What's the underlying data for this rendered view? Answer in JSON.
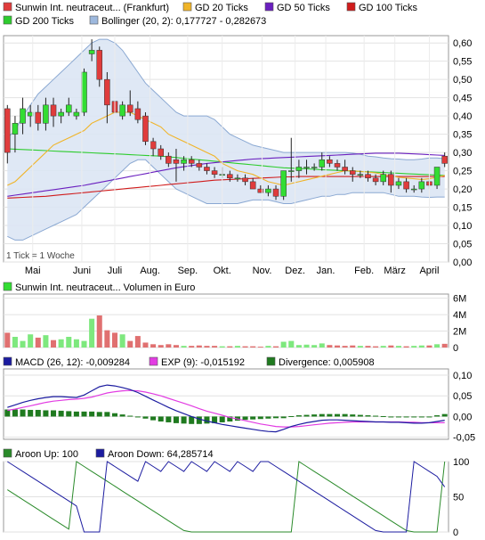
{
  "chart_data": [
    {
      "type": "candlestick",
      "legend": [
        {
          "label": "Sunwin Int. neutraceut... (Frankfurt)",
          "color": "#e03c3c"
        },
        {
          "label": "GD 20 Ticks",
          "color": "#f0b428"
        },
        {
          "label": "GD 50 Ticks",
          "color": "#6a1fbf"
        },
        {
          "label": "GD 100 Ticks",
          "color": "#d01c1c"
        },
        {
          "label": "GD 200 Ticks",
          "color": "#2ecc2e"
        },
        {
          "label": "Bollinger (20, 2): 0,177727 - 0,282673",
          "color": "#9db8dd"
        }
      ],
      "x_labels": [
        "Mai",
        "Juni",
        "Juli",
        "Aug.",
        "Sep.",
        "Okt.",
        "Nov.",
        "Dez.",
        "Jan.",
        "Feb.",
        "März",
        "April"
      ],
      "y_ticks": [
        "0,00",
        "0,05",
        "0,10",
        "0,15",
        "0,20",
        "0,25",
        "0,30",
        "0,35",
        "0,40",
        "0,45",
        "0,50",
        "0,55",
        "0,60"
      ],
      "ylim": [
        0,
        0.62
      ],
      "note": "1 Tick = 1 Woche",
      "colors": {
        "up": "#33dd33",
        "down": "#e03c3c",
        "band_fill": "#dbe6f4",
        "band_line": "#8aa8d2"
      },
      "candles": [
        [
          0.42,
          0.43,
          0.27,
          0.3
        ],
        [
          0.35,
          0.4,
          0.3,
          0.38
        ],
        [
          0.38,
          0.45,
          0.35,
          0.42
        ],
        [
          0.4,
          0.43,
          0.37,
          0.41
        ],
        [
          0.41,
          0.43,
          0.36,
          0.38
        ],
        [
          0.38,
          0.45,
          0.36,
          0.43
        ],
        [
          0.43,
          0.45,
          0.37,
          0.4
        ],
        [
          0.4,
          0.42,
          0.38,
          0.41
        ],
        [
          0.41,
          0.45,
          0.4,
          0.43
        ],
        [
          0.4,
          0.42,
          0.39,
          0.41
        ],
        [
          0.41,
          0.53,
          0.4,
          0.52
        ],
        [
          0.57,
          0.61,
          0.55,
          0.58
        ],
        [
          0.58,
          0.59,
          0.48,
          0.5
        ],
        [
          0.5,
          0.52,
          0.38,
          0.43
        ],
        [
          0.44,
          0.46,
          0.39,
          0.41
        ],
        [
          0.4,
          0.44,
          0.39,
          0.43
        ],
        [
          0.43,
          0.47,
          0.4,
          0.41
        ],
        [
          0.42,
          0.44,
          0.38,
          0.39
        ],
        [
          0.4,
          0.41,
          0.32,
          0.33
        ],
        [
          0.33,
          0.34,
          0.29,
          0.31
        ],
        [
          0.31,
          0.32,
          0.28,
          0.29
        ],
        [
          0.29,
          0.3,
          0.26,
          0.27
        ],
        [
          0.28,
          0.31,
          0.22,
          0.27
        ],
        [
          0.27,
          0.29,
          0.25,
          0.28
        ],
        [
          0.28,
          0.29,
          0.26,
          0.27
        ],
        [
          0.27,
          0.28,
          0.25,
          0.26
        ],
        [
          0.26,
          0.27,
          0.24,
          0.25
        ],
        [
          0.25,
          0.26,
          0.23,
          0.24
        ],
        [
          0.24,
          0.26,
          0.23,
          0.24
        ],
        [
          0.24,
          0.25,
          0.22,
          0.23
        ],
        [
          0.23,
          0.24,
          0.22,
          0.23
        ],
        [
          0.23,
          0.24,
          0.21,
          0.22
        ],
        [
          0.22,
          0.23,
          0.2,
          0.2
        ],
        [
          0.2,
          0.21,
          0.19,
          0.19
        ],
        [
          0.19,
          0.21,
          0.18,
          0.2
        ],
        [
          0.2,
          0.21,
          0.17,
          0.18
        ],
        [
          0.18,
          0.25,
          0.17,
          0.25
        ],
        [
          0.25,
          0.34,
          0.22,
          0.25
        ],
        [
          0.25,
          0.28,
          0.23,
          0.26
        ],
        [
          0.26,
          0.28,
          0.24,
          0.26
        ],
        [
          0.26,
          0.27,
          0.25,
          0.26
        ],
        [
          0.26,
          0.3,
          0.25,
          0.28
        ],
        [
          0.28,
          0.29,
          0.26,
          0.27
        ],
        [
          0.27,
          0.28,
          0.25,
          0.26
        ],
        [
          0.26,
          0.28,
          0.24,
          0.25
        ],
        [
          0.25,
          0.26,
          0.22,
          0.24
        ],
        [
          0.24,
          0.25,
          0.23,
          0.24
        ],
        [
          0.24,
          0.25,
          0.22,
          0.23
        ],
        [
          0.23,
          0.24,
          0.21,
          0.22
        ],
        [
          0.22,
          0.25,
          0.21,
          0.24
        ],
        [
          0.24,
          0.25,
          0.19,
          0.21
        ],
        [
          0.21,
          0.23,
          0.2,
          0.22
        ],
        [
          0.22,
          0.23,
          0.19,
          0.2
        ],
        [
          0.2,
          0.21,
          0.19,
          0.2
        ],
        [
          0.2,
          0.23,
          0.19,
          0.22
        ],
        [
          0.22,
          0.23,
          0.2,
          0.21
        ],
        [
          0.21,
          0.26,
          0.2,
          0.26
        ],
        [
          0.29,
          0.3,
          0.26,
          0.27
        ]
      ],
      "ma20": [
        0.21,
        0.22,
        0.24,
        0.26,
        0.28,
        0.3,
        0.32,
        0.33,
        0.34,
        0.35,
        0.36,
        0.38,
        0.39,
        0.4,
        0.41,
        0.41,
        0.41,
        0.4,
        0.39,
        0.38,
        0.37,
        0.35,
        0.34,
        0.33,
        0.32,
        0.31,
        0.3,
        0.29,
        0.27,
        0.26,
        0.25,
        0.245,
        0.24,
        0.23,
        0.22,
        0.215,
        0.21,
        0.215,
        0.22,
        0.225,
        0.23,
        0.235,
        0.24,
        0.245,
        0.25,
        0.25,
        0.248,
        0.246,
        0.244,
        0.24,
        0.236,
        0.232,
        0.23,
        0.228,
        0.226,
        0.228,
        0.232,
        0.237
      ],
      "ma50": [
        0.18,
        0.183,
        0.186,
        0.189,
        0.192,
        0.195,
        0.198,
        0.201,
        0.204,
        0.207,
        0.21,
        0.214,
        0.218,
        0.222,
        0.226,
        0.23,
        0.234,
        0.238,
        0.242,
        0.246,
        0.25,
        0.254,
        0.258,
        0.261,
        0.264,
        0.267,
        0.27,
        0.272,
        0.274,
        0.276,
        0.278,
        0.28,
        0.282,
        0.283,
        0.284,
        0.285,
        0.286,
        0.287,
        0.288,
        0.289,
        0.29,
        0.291,
        0.292,
        0.293,
        0.294,
        0.295,
        0.296,
        0.297,
        0.298,
        0.298,
        0.298,
        0.298,
        0.297,
        0.296,
        0.295,
        0.294,
        0.293,
        0.292
      ],
      "ma100": [
        0.175,
        0.176,
        0.177,
        0.178,
        0.179,
        0.18,
        0.182,
        0.184,
        0.186,
        0.188,
        0.19,
        0.192,
        0.194,
        0.196,
        0.198,
        0.2,
        0.202,
        0.204,
        0.206,
        0.208,
        0.21,
        0.212,
        0.214,
        0.216,
        0.218,
        0.22,
        0.222,
        0.224,
        0.225,
        0.226,
        0.227,
        0.228,
        0.229,
        0.23,
        0.231,
        0.232,
        0.233,
        0.233,
        0.234,
        0.234,
        0.234,
        0.234,
        0.234,
        0.234,
        0.234,
        0.234,
        0.234,
        0.234,
        0.234,
        0.234,
        0.234,
        0.234,
        0.234,
        0.234,
        0.234,
        0.234,
        0.234,
        0.234
      ],
      "ma200": [
        0.31,
        0.309,
        0.308,
        0.307,
        0.306,
        0.305,
        0.304,
        0.303,
        0.302,
        0.301,
        0.3,
        0.299,
        0.298,
        0.297,
        0.296,
        0.295,
        0.294,
        0.293,
        0.292,
        0.291,
        0.29,
        0.288,
        0.286,
        0.284,
        0.282,
        0.28,
        0.278,
        0.276,
        0.274,
        0.272,
        0.27,
        0.268,
        0.266,
        0.264,
        0.262,
        0.26,
        0.258,
        0.257,
        0.256,
        0.255,
        0.254,
        0.253,
        0.252,
        0.251,
        0.25,
        0.249,
        0.248,
        0.247,
        0.246,
        0.245,
        0.244,
        0.243,
        0.242,
        0.241,
        0.24,
        0.239,
        0.238,
        0.237
      ],
      "boll_upper": [
        0.34,
        0.36,
        0.4,
        0.43,
        0.46,
        0.48,
        0.5,
        0.52,
        0.54,
        0.56,
        0.58,
        0.6,
        0.61,
        0.61,
        0.6,
        0.58,
        0.55,
        0.52,
        0.49,
        0.47,
        0.45,
        0.43,
        0.41,
        0.4,
        0.4,
        0.4,
        0.4,
        0.39,
        0.37,
        0.35,
        0.34,
        0.33,
        0.32,
        0.315,
        0.31,
        0.305,
        0.3,
        0.3,
        0.3,
        0.3,
        0.3,
        0.3,
        0.3,
        0.3,
        0.3,
        0.298,
        0.295,
        0.29,
        0.288,
        0.285,
        0.283,
        0.282,
        0.28,
        0.28,
        0.282,
        0.285,
        0.285,
        0.283
      ],
      "boll_lower": [
        0.07,
        0.06,
        0.06,
        0.07,
        0.08,
        0.09,
        0.1,
        0.11,
        0.12,
        0.13,
        0.15,
        0.17,
        0.19,
        0.21,
        0.23,
        0.25,
        0.27,
        0.28,
        0.28,
        0.26,
        0.24,
        0.22,
        0.2,
        0.19,
        0.18,
        0.17,
        0.16,
        0.16,
        0.16,
        0.16,
        0.16,
        0.165,
        0.17,
        0.17,
        0.17,
        0.165,
        0.16,
        0.16,
        0.165,
        0.17,
        0.175,
        0.18,
        0.18,
        0.185,
        0.185,
        0.19,
        0.19,
        0.19,
        0.19,
        0.19,
        0.185,
        0.18,
        0.18,
        0.18,
        0.178,
        0.177,
        0.178,
        0.178
      ]
    },
    {
      "type": "bar",
      "legend": [
        {
          "label": "Sunwin Int. neutraceut... Volumen in Euro",
          "color": "#33dd33"
        }
      ],
      "y_ticks": [
        "0",
        "2M",
        "4M",
        "6M"
      ],
      "ylim": [
        0,
        6500000
      ],
      "values": [
        1800000,
        1300000,
        800000,
        1600000,
        1200000,
        1500000,
        900000,
        1000000,
        1300000,
        1000000,
        800000,
        3500000,
        3900000,
        2100000,
        1800000,
        1600000,
        800000,
        1400000,
        600000,
        400000,
        300000,
        400000,
        300000,
        200000,
        200000,
        250000,
        200000,
        200000,
        150000,
        150000,
        200000,
        150000,
        150000,
        100000,
        200000,
        150000,
        700000,
        800000,
        300000,
        350000,
        300000,
        500000,
        300000,
        250000,
        200000,
        250000,
        200000,
        200000,
        150000,
        200000,
        250000,
        200000,
        150000,
        200000,
        250000,
        250000,
        400000,
        450000
      ]
    },
    {
      "type": "line",
      "legend": [
        {
          "label": "MACD (26, 12): -0,009284",
          "color": "#1c1ca0"
        },
        {
          "label": "EXP (9): -0,015192",
          "color": "#e23ce2"
        },
        {
          "label": "Divergence: 0,005908",
          "color": "#1f7a1f"
        }
      ],
      "y_ticks": [
        "-0,05",
        "0,00",
        "0,05",
        "0,10"
      ],
      "ylim": [
        -0.055,
        0.115
      ],
      "macd": [
        0.022,
        0.028,
        0.034,
        0.039,
        0.043,
        0.046,
        0.048,
        0.048,
        0.047,
        0.046,
        0.052,
        0.062,
        0.072,
        0.076,
        0.074,
        0.07,
        0.065,
        0.058,
        0.049,
        0.04,
        0.031,
        0.022,
        0.014,
        0.007,
        0.0,
        -0.006,
        -0.011,
        -0.015,
        -0.019,
        -0.022,
        -0.025,
        -0.028,
        -0.031,
        -0.034,
        -0.036,
        -0.037,
        -0.031,
        -0.024,
        -0.019,
        -0.015,
        -0.012,
        -0.009,
        -0.008,
        -0.008,
        -0.009,
        -0.01,
        -0.011,
        -0.012,
        -0.013,
        -0.013,
        -0.014,
        -0.014,
        -0.015,
        -0.016,
        -0.016,
        -0.015,
        -0.012,
        -0.009
      ],
      "signal": [
        0.015,
        0.018,
        0.022,
        0.026,
        0.03,
        0.034,
        0.037,
        0.039,
        0.041,
        0.042,
        0.044,
        0.047,
        0.052,
        0.057,
        0.06,
        0.062,
        0.063,
        0.062,
        0.059,
        0.055,
        0.05,
        0.044,
        0.038,
        0.032,
        0.026,
        0.019,
        0.013,
        0.008,
        0.003,
        -0.002,
        -0.006,
        -0.01,
        -0.014,
        -0.018,
        -0.021,
        -0.024,
        -0.025,
        -0.025,
        -0.024,
        -0.022,
        -0.02,
        -0.018,
        -0.016,
        -0.015,
        -0.014,
        -0.013,
        -0.013,
        -0.013,
        -0.013,
        -0.013,
        -0.013,
        -0.013,
        -0.014,
        -0.014,
        -0.015,
        -0.015,
        -0.015,
        -0.015
      ],
      "divergence": [
        0.017,
        0.017,
        0.017,
        0.016,
        0.016,
        0.015,
        0.015,
        0.014,
        0.013,
        0.012,
        0.012,
        0.012,
        0.011,
        0.011,
        0.008,
        0.005,
        0.002,
        -0.001,
        -0.005,
        -0.009,
        -0.012,
        -0.014,
        -0.016,
        -0.017,
        -0.018,
        -0.018,
        -0.017,
        -0.016,
        -0.014,
        -0.012,
        -0.01,
        -0.008,
        -0.007,
        -0.006,
        -0.005,
        -0.004,
        -0.004,
        0.001,
        0.003,
        0.004,
        0.005,
        0.006,
        0.006,
        0.006,
        0.006,
        0.005,
        0.004,
        0.003,
        0.002,
        0.001,
        0.0,
        -0.001,
        -0.001,
        -0.002,
        -0.002,
        -0.001,
        0.003,
        0.006
      ]
    },
    {
      "type": "line",
      "legend": [
        {
          "label": "Aroon Up: 100",
          "color": "#2a8a2a"
        },
        {
          "label": "Aroon Down: 64,285714",
          "color": "#1c1ca0"
        }
      ],
      "y_ticks": [
        "0",
        "50",
        "100"
      ],
      "ylim": [
        0,
        100
      ],
      "aroon_up": [
        60,
        53,
        46,
        39,
        32,
        25,
        18,
        11,
        4,
        100,
        93,
        86,
        79,
        72,
        65,
        58,
        51,
        44,
        37,
        30,
        23,
        16,
        9,
        2,
        0,
        0,
        0,
        0,
        0,
        0,
        0,
        0,
        0,
        0,
        0,
        0,
        0,
        0,
        100,
        93,
        86,
        79,
        72,
        65,
        58,
        51,
        44,
        37,
        30,
        23,
        16,
        9,
        2,
        0,
        0,
        0,
        0,
        100
      ],
      "aroon_down": [
        100,
        93,
        86,
        79,
        72,
        65,
        58,
        51,
        44,
        37,
        0,
        0,
        0,
        100,
        93,
        86,
        79,
        72,
        100,
        93,
        86,
        100,
        93,
        86,
        100,
        93,
        86,
        100,
        93,
        86,
        100,
        93,
        86,
        100,
        100,
        93,
        86,
        79,
        72,
        65,
        58,
        51,
        44,
        37,
        30,
        23,
        16,
        9,
        2,
        0,
        0,
        0,
        0,
        100,
        93,
        86,
        79,
        64
      ]
    }
  ]
}
